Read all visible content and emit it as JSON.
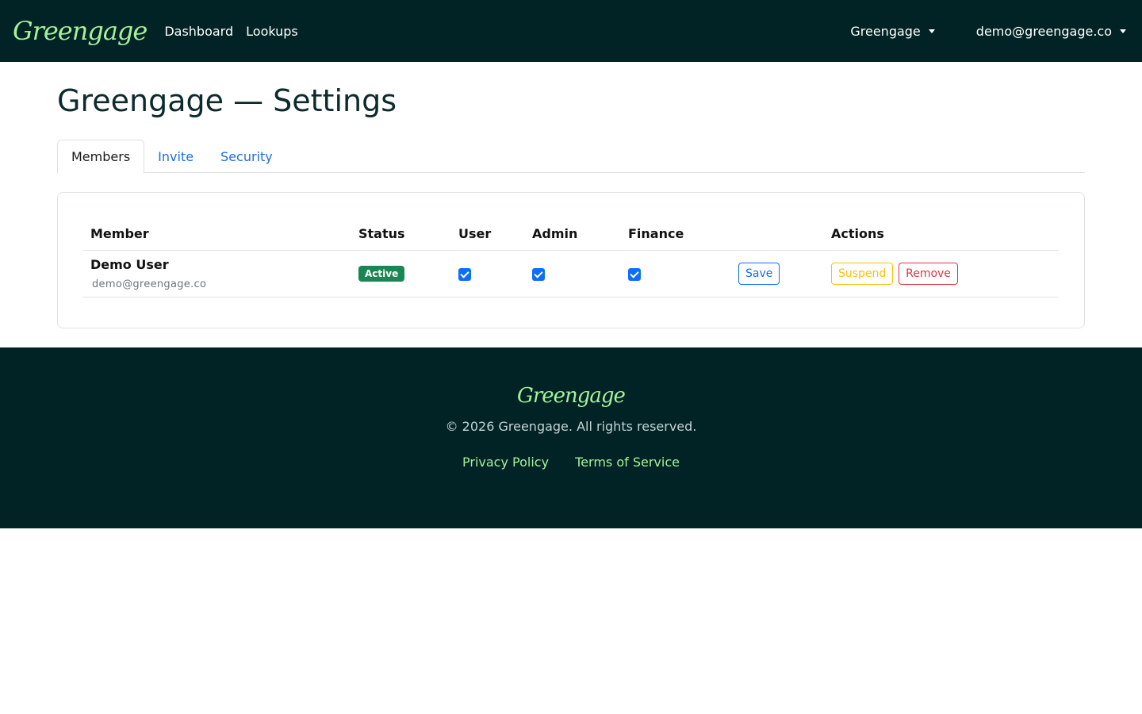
{
  "navbar": {
    "brand": "Greengage",
    "links": [
      "Dashboard",
      "Lookups"
    ],
    "org_dropdown": "Greengage",
    "user_dropdown": "demo@greengage.co"
  },
  "page": {
    "title": "Greengage — Settings"
  },
  "tabs": [
    {
      "label": "Members",
      "active": true
    },
    {
      "label": "Invite",
      "active": false
    },
    {
      "label": "Security",
      "active": false
    }
  ],
  "members_table": {
    "headers": [
      "Member",
      "Status",
      "User",
      "Admin",
      "Finance",
      "",
      "Actions"
    ],
    "rows": [
      {
        "name": "Demo User",
        "email": "demo@greengage.co",
        "status": "Active",
        "user": true,
        "admin": true,
        "finance": true,
        "save_label": "Save",
        "suspend_label": "Suspend",
        "remove_label": "Remove"
      }
    ]
  },
  "footer": {
    "brand": "Greengage",
    "copyright": "© 2026 Greengage. All rights reserved.",
    "links": [
      "Privacy Policy",
      "Terms of Service"
    ]
  },
  "colors": {
    "navbar_bg": "#012326",
    "brand_green": "#a4f19a",
    "primary": "#0d6efd",
    "success": "#198754",
    "warning": "#ffc107",
    "danger": "#dc3545"
  }
}
